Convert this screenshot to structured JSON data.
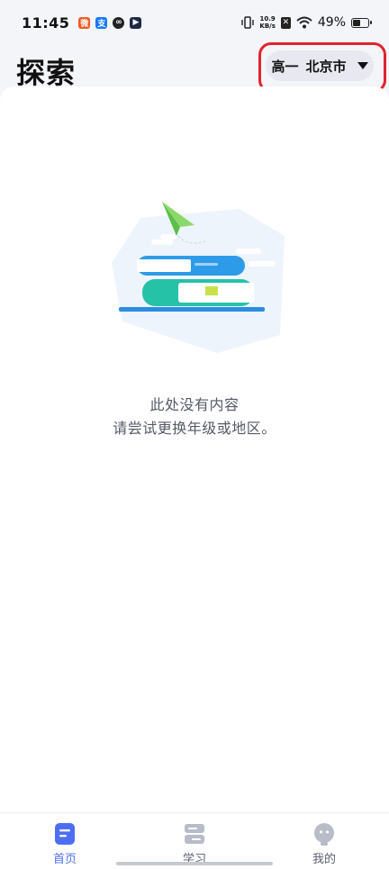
{
  "status_bar": {
    "time": "11:45",
    "net_speed_value": "10.9",
    "net_speed_unit": "KB/s",
    "battery": "49%",
    "app_icons": [
      "weibo-notification-icon",
      "alipay-notification-icon",
      "link-notification-icon",
      "video-notification-icon"
    ]
  },
  "header": {
    "title": "探索",
    "selector": {
      "grade": "高一",
      "region": "北京市"
    }
  },
  "empty_state": {
    "line1": "此处没有内容",
    "line2": "请尝试更换年级或地区。"
  },
  "bottom_nav": {
    "items": [
      {
        "label": "首页",
        "icon": "home-doc-icon",
        "active": true
      },
      {
        "label": "学习",
        "icon": "study-stack-icon",
        "active": false
      },
      {
        "label": "我的",
        "icon": "profile-face-icon",
        "active": false
      }
    ]
  },
  "colors": {
    "accent": "#4e6ef2",
    "highlight": "#e0232e",
    "background": "#f4f5f9"
  }
}
